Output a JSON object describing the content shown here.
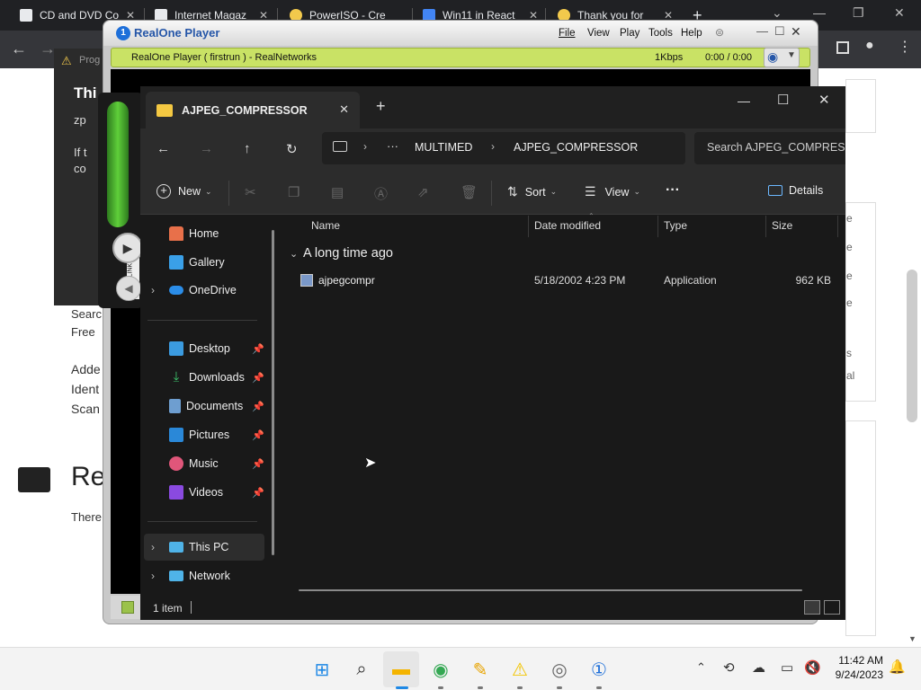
{
  "browser": {
    "tabs": [
      {
        "title": "CD and DVD Co",
        "color": "#e8eaed"
      },
      {
        "title": "Internet Magaz",
        "color": "#e8eaed"
      },
      {
        "title": "PowerISO - Cre",
        "color": "#f2c94c"
      },
      {
        "title": "Win11 in React",
        "color": "#4285f4"
      },
      {
        "title": "Thank you for",
        "color": "#f2c94c"
      }
    ],
    "new_tab": "+"
  },
  "webpage": {
    "dialog_title": "Thi",
    "dialog_line1": "zp",
    "dialog_line2": "If t",
    "dialog_line3": "co",
    "prog_label": "Prog",
    "search_line1": "Searc",
    "search_line2": "Free",
    "added_1": "Adde",
    "added_2": "Ident",
    "added_3": "Scan",
    "heading": "Re",
    "there": "There",
    "side_e": [
      "e",
      "e",
      "e",
      "e",
      "s",
      "al"
    ]
  },
  "realone": {
    "app_name": "RealOne Player",
    "menu": [
      "File",
      "View",
      "Play",
      "Tools",
      "Help"
    ],
    "status_title": "RealOne Player ( firstrun ) - RealNetworks",
    "bitrate": "1Kbps",
    "time": "0:00 / 0:00",
    "links_label": "LINKS"
  },
  "explorer": {
    "tab_title": "AJPEG_COMPRESSOR",
    "new_tab": "+",
    "breadcrumb": [
      "MULTIMED",
      "AJPEG_COMPRESSOR"
    ],
    "more": "···",
    "search_placeholder": "Search AJPEG_COMPRESSOR",
    "commands": {
      "new": "New",
      "sort": "Sort",
      "view": "View",
      "details": "Details",
      "more": "···"
    },
    "nav": {
      "home": "Home",
      "gallery": "Gallery",
      "onedrive": "OneDrive",
      "desktop": "Desktop",
      "downloads": "Downloads",
      "documents": "Documents",
      "pictures": "Pictures",
      "music": "Music",
      "videos": "Videos",
      "thispc": "This PC",
      "network": "Network"
    },
    "columns": {
      "name": "Name",
      "date": "Date modified",
      "type": "Type",
      "size": "Size"
    },
    "group": "A long time ago",
    "files": [
      {
        "name": "ajpegcompr",
        "date": "5/18/2002 4:23 PM",
        "type": "Application",
        "size": "962 KB"
      }
    ],
    "status": "1 item"
  },
  "taskbar": {
    "time": "11:42 AM",
    "date": "9/24/2023"
  }
}
